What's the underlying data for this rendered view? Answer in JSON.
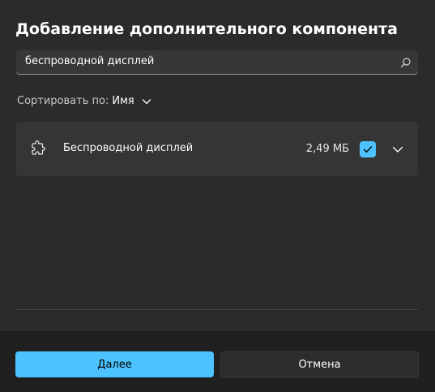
{
  "dialog": {
    "title": "Добавление дополнительного компонента"
  },
  "search": {
    "value": "беспроводной дисплей",
    "icon": "search-icon"
  },
  "sort": {
    "label": "Сортировать по:",
    "value": "Имя"
  },
  "features": [
    {
      "name": "Беспроводной дисплей",
      "size": "2,49 МБ",
      "checked": true,
      "icon": "puzzle-icon"
    }
  ],
  "footer": {
    "next_label": "Далее",
    "cancel_label": "Отмена"
  },
  "colors": {
    "accent": "#4cc2ff",
    "background": "#2b2b2b",
    "card": "#353535"
  }
}
